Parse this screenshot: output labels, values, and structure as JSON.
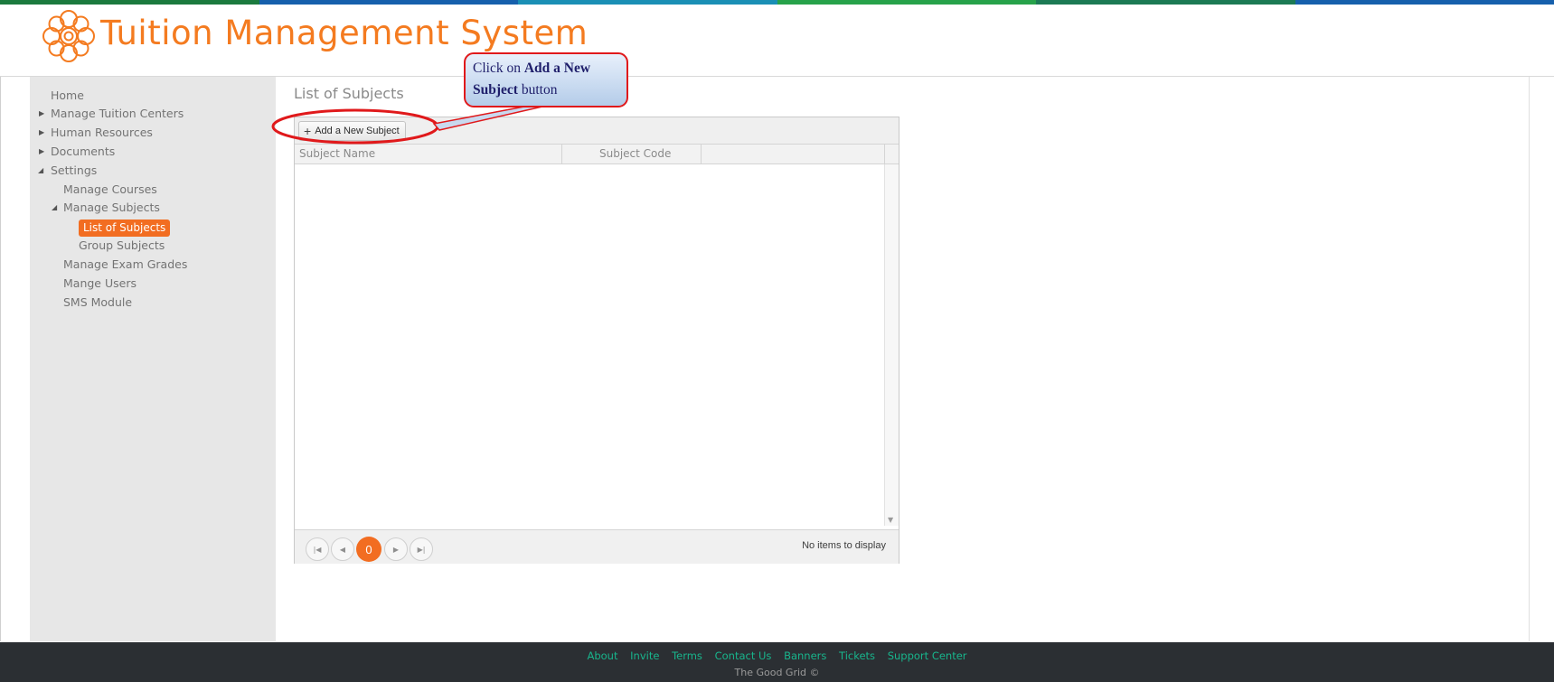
{
  "header": {
    "title": "Tuition Management System",
    "logo_icon": "gear-flower-logo-icon",
    "stripe_colors": [
      "#1b7a3e",
      "#1660ac",
      "#1a8fb5",
      "#27a24a",
      "#1c7a54",
      "#1660ac"
    ]
  },
  "sidebar": {
    "items": [
      {
        "label": "Home"
      },
      {
        "label": "Manage Tuition Centers"
      },
      {
        "label": "Human Resources"
      },
      {
        "label": "Documents"
      },
      {
        "label": "Settings"
      },
      {
        "label": "Manage Courses"
      },
      {
        "label": "Manage Subjects"
      },
      {
        "label": "List of Subjects"
      },
      {
        "label": "Group Subjects"
      },
      {
        "label": "Manage Exam Grades"
      },
      {
        "label": "Mange Users"
      },
      {
        "label": "SMS Module"
      }
    ]
  },
  "main": {
    "title": "List of Subjects",
    "add_button_label": "Add a New Subject",
    "columns": [
      "Subject Name",
      "Subject Code"
    ],
    "rows": [],
    "pager": {
      "current_page": "0",
      "info": "No items to display"
    }
  },
  "callout": {
    "pre": "Click on ",
    "bold": "Add a New Subject",
    "post": " button"
  },
  "footer": {
    "links": [
      "About",
      "Invite",
      "Terms",
      "Contact Us",
      "Banners",
      "Tickets",
      "Support Center"
    ],
    "copyright": "The Good Grid ©"
  },
  "colors": {
    "accent": "#f26d21",
    "title": "#f47b20",
    "footer_bg": "#2b2f33",
    "footer_link": "#18b58c",
    "callout_border": "#e0191b"
  }
}
